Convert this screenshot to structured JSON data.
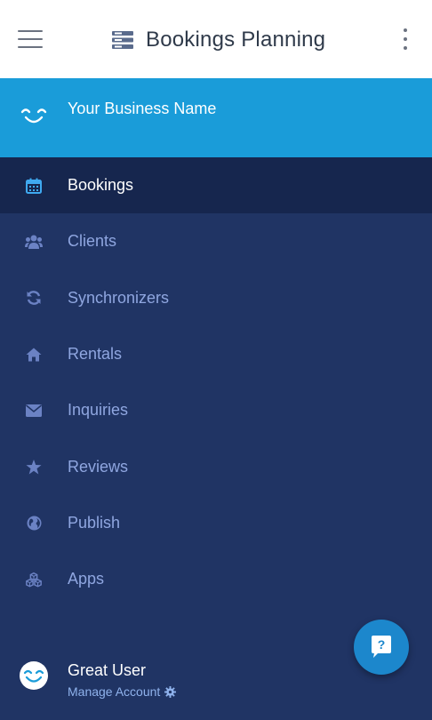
{
  "topbar": {
    "title": "Bookings Planning",
    "menu_icon": "hamburger-icon",
    "title_icon": "server-icon",
    "more_icon": "kebab-icon"
  },
  "business": {
    "name": "Your Business Name",
    "logo_icon": "smile-logo-icon"
  },
  "nav": {
    "items": [
      {
        "label": "Bookings",
        "icon": "calendar-icon",
        "active": true
      },
      {
        "label": "Clients",
        "icon": "users-icon",
        "active": false
      },
      {
        "label": "Synchronizers",
        "icon": "refresh-icon",
        "active": false
      },
      {
        "label": "Rentals",
        "icon": "home-icon",
        "active": false
      },
      {
        "label": "Inquiries",
        "icon": "envelope-icon",
        "active": false
      },
      {
        "label": "Reviews",
        "icon": "star-icon",
        "active": false
      },
      {
        "label": "Publish",
        "icon": "globe-icon",
        "active": false
      },
      {
        "label": "Apps",
        "icon": "cubes-icon",
        "active": false
      }
    ]
  },
  "user": {
    "name": "Great User",
    "manage_label": "Manage Account",
    "avatar_icon": "smile-avatar-icon",
    "manage_icon": "gear-icon"
  },
  "help": {
    "glyph": "?",
    "icon": "help-chat-icon"
  },
  "colors": {
    "topbar_bg": "#ffffff",
    "header_bg": "#1a9cd9",
    "sidebar_bg": "#203464",
    "active_bg": "#16264e",
    "nav_text": "#8fa6e0",
    "active_text": "#ffffff",
    "help_bg": "#1c87cc"
  }
}
